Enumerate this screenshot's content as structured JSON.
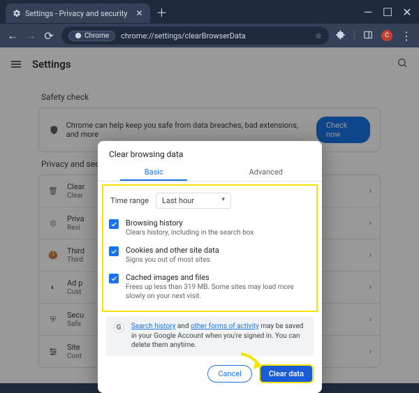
{
  "window": {
    "tab_title": "Settings - Privacy and security",
    "url_chip": "Chrome",
    "url_text": "chrome://settings/clearBrowserData",
    "avatar_letter": "C"
  },
  "page": {
    "header": "Settings",
    "safety_section": "Safety check",
    "safety_text": "Chrome can help keep you safe from data breaches, bad extensions, and more",
    "check_now": "Check now",
    "privacy_section": "Privacy and security",
    "rows": [
      {
        "title": "Clear",
        "sub": "Clear"
      },
      {
        "title": "Priva",
        "sub": "Revi"
      },
      {
        "title": "Third",
        "sub": "Third"
      },
      {
        "title": "Ad p",
        "sub": "Cust"
      },
      {
        "title": "Secu",
        "sub": "Safe"
      },
      {
        "title": "Site",
        "sub": "Cont"
      }
    ]
  },
  "modal": {
    "title": "Clear browsing data",
    "tab_basic": "Basic",
    "tab_advanced": "Advanced",
    "time_range_label": "Time range",
    "time_range_value": "Last hour",
    "items": [
      {
        "title": "Browsing history",
        "sub": "Clears history, including in the search box"
      },
      {
        "title": "Cookies and other site data",
        "sub": "Signs you out of most sites"
      },
      {
        "title": "Cached images and files",
        "sub": "Frees up less than 319 MB. Some sites may load more slowly on your next visit."
      }
    ],
    "info_link1": "Search history",
    "info_mid": " and ",
    "info_link2": "other forms of activity",
    "info_tail": " may be saved in your Google Account when you're signed in. You can delete them anytime.",
    "cancel": "Cancel",
    "clear": "Clear data"
  }
}
